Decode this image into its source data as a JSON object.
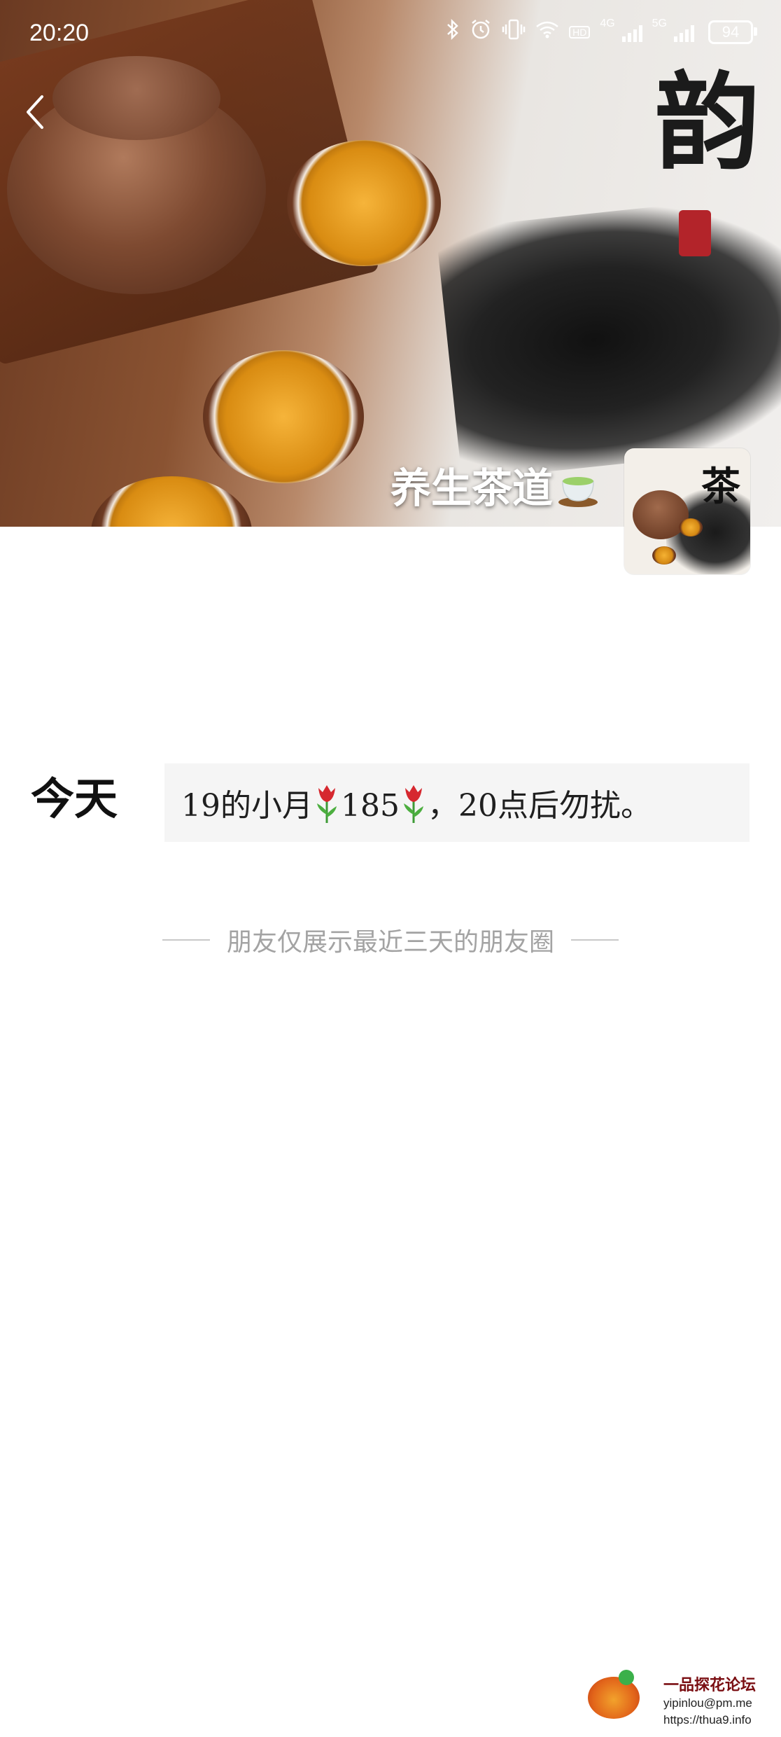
{
  "status_bar": {
    "time": "20:20",
    "network_1": "4G",
    "network_2": "5G",
    "hd_label": "HD",
    "battery": "94"
  },
  "cover": {
    "calligraphy": "韵"
  },
  "profile": {
    "name": "养生茶道",
    "avatar_char": "茶"
  },
  "post": {
    "date_label": "今天",
    "text_part1": "19的小月",
    "text_part2": "185",
    "text_part3": "，20点后勿扰。"
  },
  "notice": {
    "text": "朋友仅展示最近三天的朋友圈"
  },
  "watermark": {
    "title": "一品探花论坛",
    "email": "yipinlou@pm.me",
    "url": "https://thua9.info"
  },
  "colors": {
    "notice_text": "#a3a3a3",
    "post_card_bg": "#f5f5f5"
  },
  "icons": [
    "back-arrow-icon",
    "bluetooth-icon",
    "alarm-icon",
    "vibrate-icon",
    "wifi-icon",
    "signal-icon",
    "battery-icon",
    "tulip-icon",
    "tea-cup-icon"
  ]
}
